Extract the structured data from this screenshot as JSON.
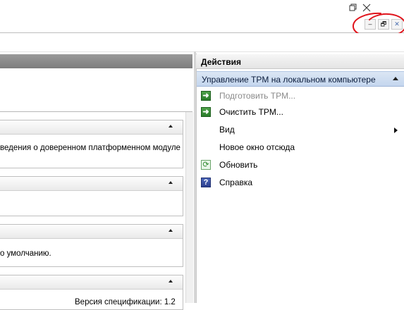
{
  "window": {
    "restore_icon": "restore-icon",
    "close_icon": "close-icon"
  },
  "inner_controls": {
    "minimize": "–",
    "restore": "🗗",
    "close": "✕"
  },
  "left": {
    "sections": [
      {
        "body": "ведения о доверенном платформенном модуле"
      },
      {
        "body": ""
      },
      {
        "body": "о умолчанию."
      },
      {
        "body": "Версия спецификации:  1.2"
      }
    ]
  },
  "actions": {
    "title": "Действия",
    "group_title": "Управление TPM на локальном компьютере",
    "items": [
      {
        "label": "Подготовить TPM...",
        "icon": "arrow-right-icon",
        "enabled": false
      },
      {
        "label": "Очистить TPM...",
        "icon": "arrow-right-icon",
        "enabled": true
      },
      {
        "label": "Вид",
        "icon": "",
        "enabled": true,
        "submenu": true
      },
      {
        "label": "Новое окно отсюда",
        "icon": "",
        "enabled": true
      },
      {
        "label": "Обновить",
        "icon": "refresh-icon",
        "enabled": true
      },
      {
        "label": "Справка",
        "icon": "help-icon",
        "enabled": true
      }
    ]
  },
  "colors": {
    "annotation": "#e0141c",
    "group_header": "#c4d6ee"
  }
}
